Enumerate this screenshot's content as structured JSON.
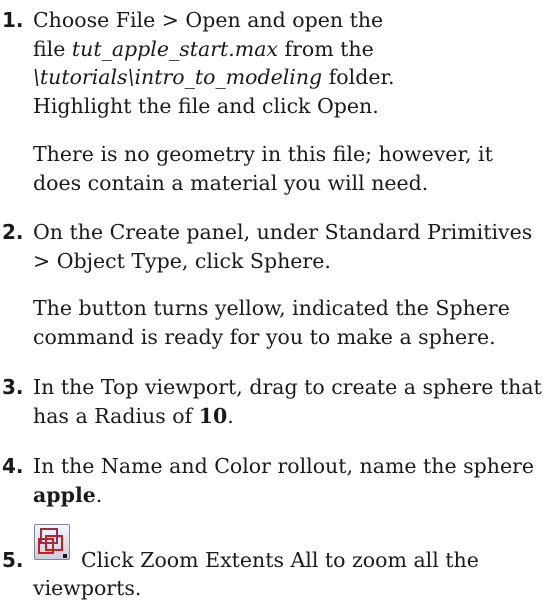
{
  "steps": [
    {
      "number": "1.",
      "lines": [
        [
          "Choose File > Open and open the"
        ],
        [
          "file ",
          "tut_apple_start.max",
          " from the"
        ],
        [
          "\\tutorials\\intro_to_modeling",
          " folder."
        ],
        [
          "Highlight the file and click Open."
        ]
      ],
      "note": [
        "There is no geometry in this file; however, it",
        "does contain a material you will need."
      ]
    },
    {
      "number": "2.",
      "lines": [
        [
          "On the Create panel, under Standard Primitives"
        ],
        [
          "> Object Type, click Sphere."
        ]
      ],
      "note": [
        "The button turns yellow, indicated the Sphere",
        "command is ready for you to make a sphere."
      ]
    },
    {
      "number": "3.",
      "lines": [
        [
          "In the Top viewport, drag to create a sphere that"
        ],
        [
          "has a Radius of ",
          "10",
          "."
        ]
      ]
    },
    {
      "number": "4.",
      "lines": [
        [
          "In the Name and Color rollout, name the sphere"
        ],
        [
          "apple",
          "."
        ]
      ]
    },
    {
      "number": "5.",
      "icon": "zoom-extents-all-icon",
      "lines": [
        [
          "Click Zoom Extents All to zoom all the"
        ],
        [
          "viewports."
        ]
      ]
    }
  ]
}
